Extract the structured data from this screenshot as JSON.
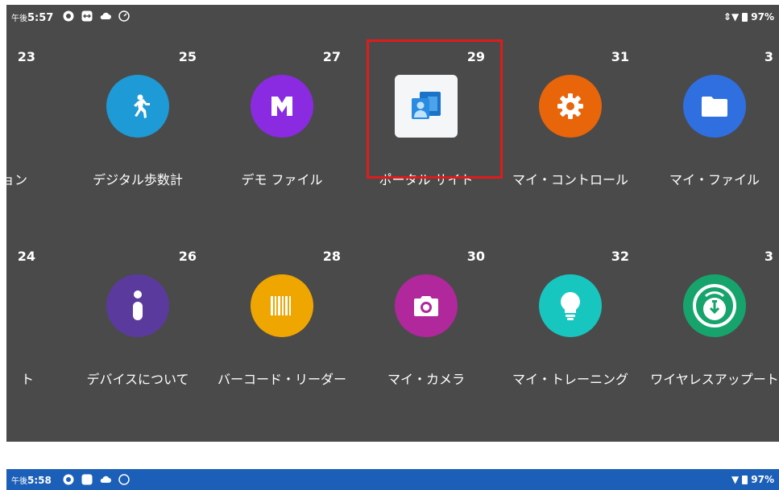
{
  "status_top": {
    "prefix": "午後",
    "time": "5:57",
    "battery": "97%"
  },
  "status_bottom": {
    "prefix": "午後",
    "time": "5:58",
    "battery": "97%"
  },
  "row1": [
    {
      "num": "23",
      "label": "ョン"
    },
    {
      "num": "25",
      "label": "デジタル歩数計",
      "icon": "walking-person-icon",
      "color": "#1e9ad6"
    },
    {
      "num": "27",
      "label": "デモ ファイル",
      "icon": "demo-file-icon",
      "color": "#8a2be2"
    },
    {
      "num": "29",
      "label": "ポータル サイト",
      "icon": "portal-site-icon"
    },
    {
      "num": "31",
      "label": "マイ・コントロール",
      "icon": "gear-icon",
      "color": "#e8650a"
    },
    {
      "num": "3",
      "label": "マイ・ファイル",
      "icon": "folder-icon",
      "color": "#2f6fe0"
    }
  ],
  "row2": [
    {
      "num": "24",
      "label": "ト"
    },
    {
      "num": "26",
      "label": "デバイスについて",
      "icon": "info-icon",
      "color": "#5b3a9e"
    },
    {
      "num": "28",
      "label": "バーコード・リーダー",
      "icon": "barcode-icon",
      "color": "#f0a600"
    },
    {
      "num": "30",
      "label": "マイ・カメラ",
      "icon": "camera-icon",
      "color": "#b0289c"
    },
    {
      "num": "32",
      "label": "マイ・トレーニング",
      "icon": "lightbulb-icon",
      "color": "#18c6c0"
    },
    {
      "num": "3",
      "label": "ワイヤレスアップート",
      "icon": "wireless-update-icon",
      "color": "#16a46c"
    }
  ]
}
